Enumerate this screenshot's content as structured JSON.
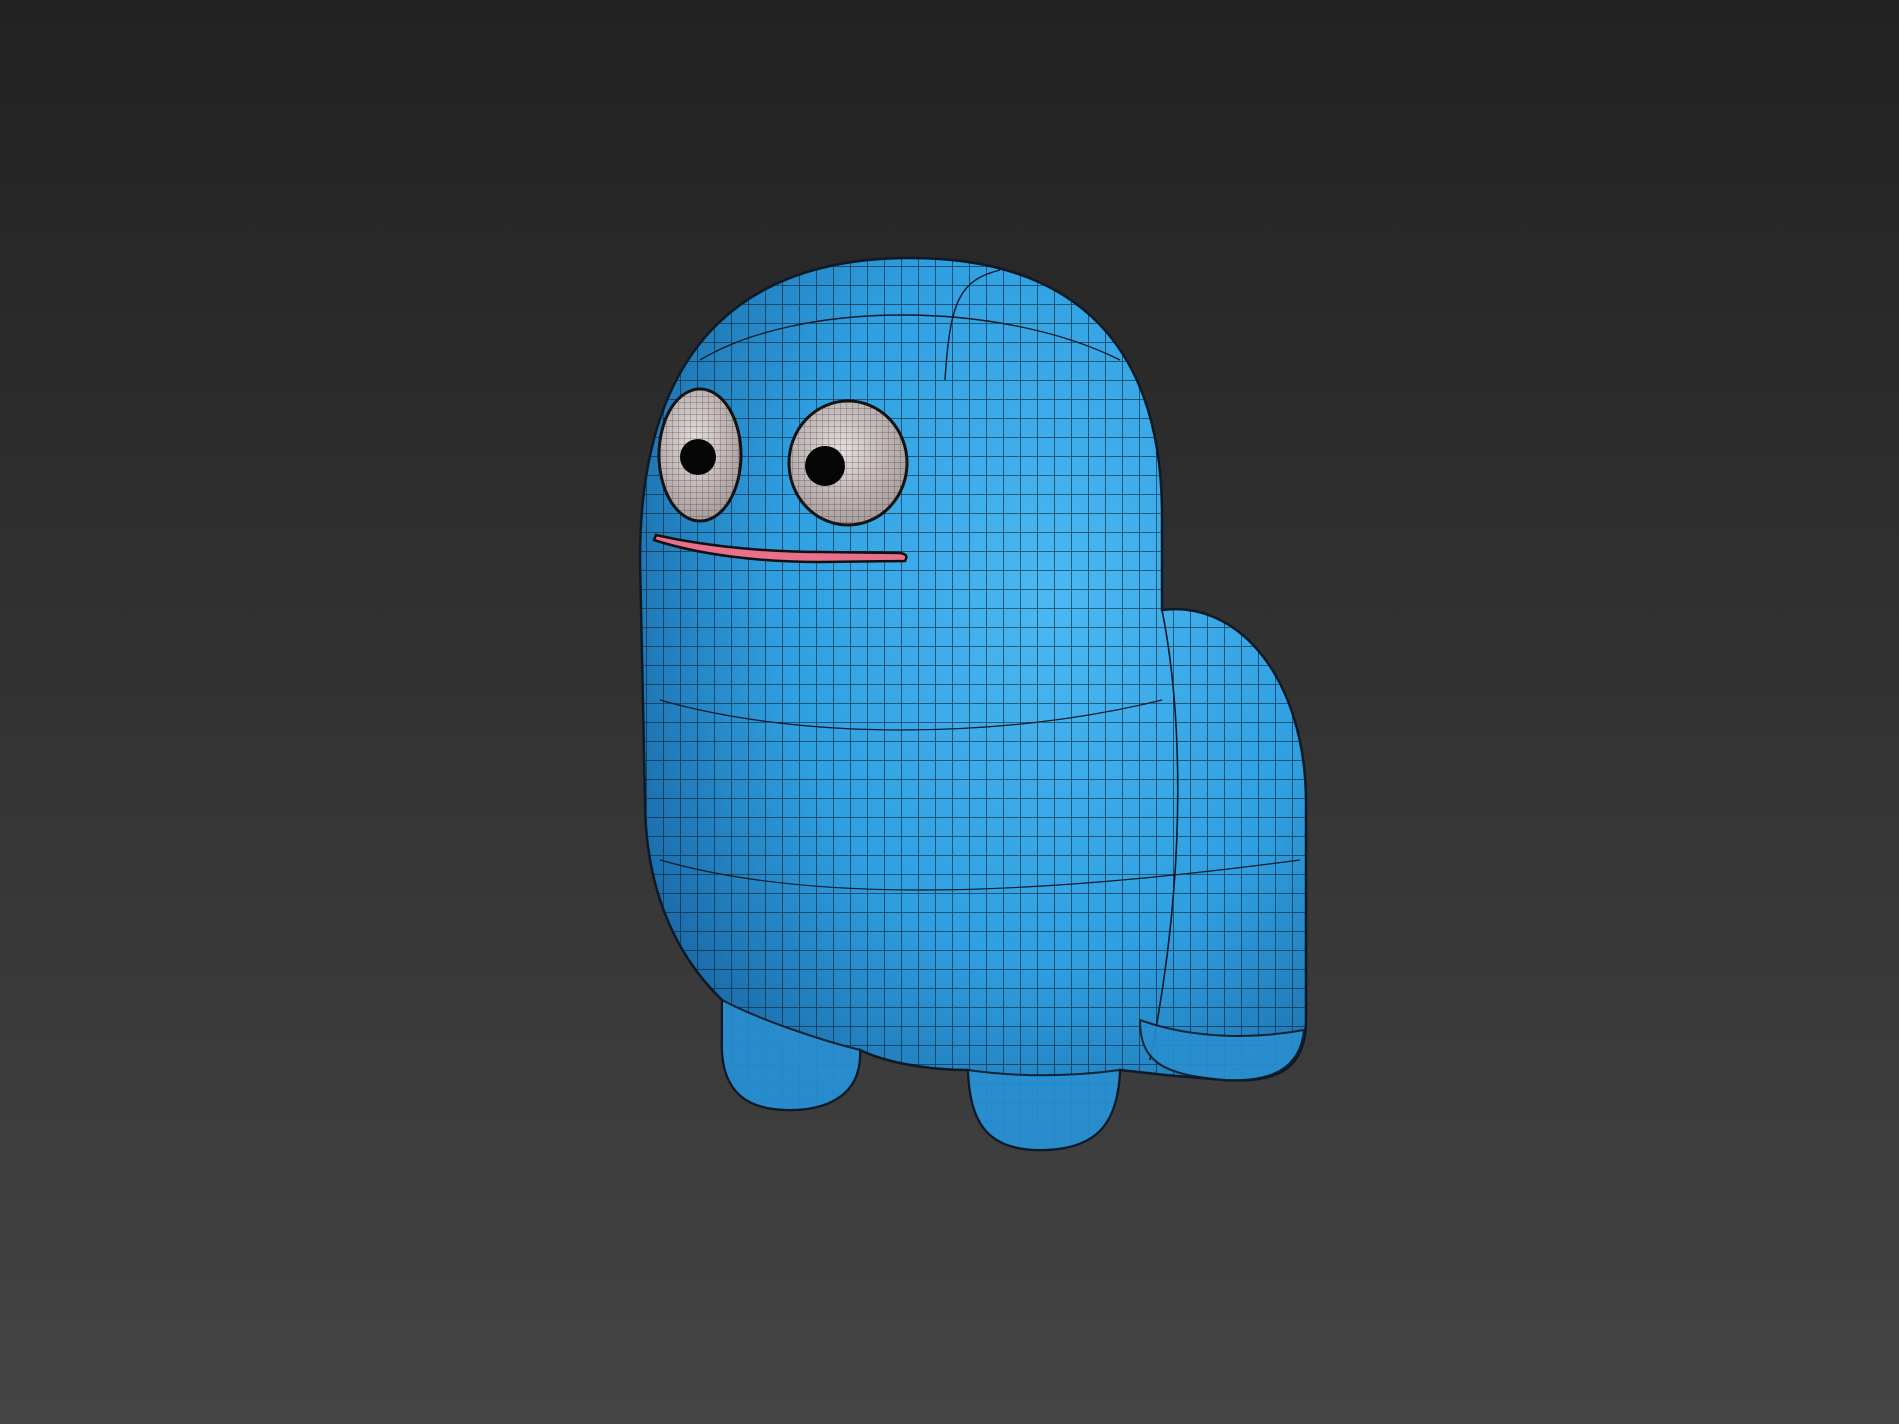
{
  "viewport": {
    "background_top": "#222222",
    "background_bottom": "#444444"
  },
  "model": {
    "subject": "blue-blob-creature",
    "body_color": "#2f9fe0",
    "body_shade_color": "#1a6aa8",
    "wire_color": "#0c1a28",
    "eye_white_color": "#cfc6c6",
    "pupil_color": "#050505",
    "mouth_color": "#e8708a",
    "display_mode": "shaded-with-wireframe"
  }
}
